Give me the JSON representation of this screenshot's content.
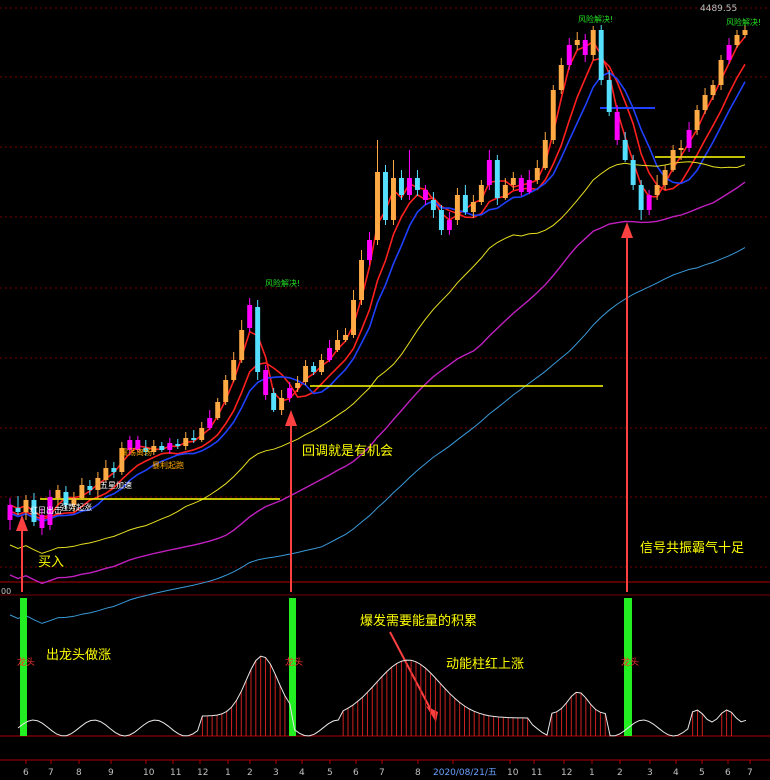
{
  "chart_data": {
    "type": "candlestick",
    "price_label": "4489.55",
    "left_marker": "00",
    "x_ticks": [
      "6",
      "7",
      "8",
      "9",
      "10",
      "11",
      "12",
      "1",
      "2",
      "3",
      "4",
      "5",
      "6",
      "7",
      "8",
      "2020/08/21/五",
      "10",
      "11",
      "12",
      "1",
      "2",
      "3",
      "4",
      "5",
      "6",
      "7"
    ],
    "bottom_date": "2020/08/21/五",
    "annotations": {
      "buy": "买入",
      "pullback": "回调就是有机会",
      "resonance": "信号共振霸气十足",
      "dragon_out": "出龙头做涨",
      "energy": "爆发需要能量的积累",
      "momentum": "动能柱红上涨",
      "dragon_tag": "龙头",
      "risk": "风险解决!",
      "small_labels": [
        "震荡离场",
        "红日出击",
        "五星加速",
        "暴利起跑",
        "强势起涨"
      ]
    },
    "candles": [
      [
        520,
        505,
        530,
        498
      ],
      [
        508,
        512,
        515,
        496
      ],
      [
        512,
        500,
        520,
        495
      ],
      [
        500,
        522,
        526,
        493
      ],
      [
        515,
        528,
        535,
        508
      ],
      [
        525,
        497,
        530,
        490
      ],
      [
        498,
        490,
        505,
        485
      ],
      [
        492,
        505,
        508,
        486
      ],
      [
        505,
        498,
        512,
        492
      ],
      [
        498,
        485,
        500,
        478
      ],
      [
        486,
        490,
        495,
        480
      ],
      [
        490,
        478,
        498,
        472
      ],
      [
        480,
        468,
        482,
        460
      ],
      [
        468,
        472,
        478,
        462
      ],
      [
        472,
        448,
        475,
        442
      ],
      [
        450,
        440,
        455,
        436
      ],
      [
        440,
        450,
        452,
        436
      ],
      [
        448,
        452,
        456,
        440
      ],
      [
        452,
        446,
        455,
        440
      ],
      [
        446,
        450,
        452,
        442
      ],
      [
        450,
        443,
        454,
        438
      ],
      [
        444,
        446,
        449,
        439
      ],
      [
        446,
        438,
        450,
        432
      ],
      [
        438,
        440,
        443,
        430
      ],
      [
        440,
        428,
        442,
        422
      ],
      [
        428,
        418,
        430,
        410
      ],
      [
        418,
        402,
        420,
        398
      ],
      [
        402,
        380,
        405,
        375
      ],
      [
        380,
        360,
        382,
        352
      ],
      [
        360,
        330,
        363,
        320
      ],
      [
        328,
        305,
        332,
        298
      ],
      [
        307,
        372,
        380,
        300
      ],
      [
        370,
        395,
        400,
        365
      ],
      [
        393,
        410,
        412,
        388
      ],
      [
        410,
        398,
        415,
        390
      ],
      [
        398,
        388,
        402,
        382
      ],
      [
        388,
        383,
        392,
        376
      ],
      [
        382,
        366,
        385,
        360
      ],
      [
        366,
        372,
        375,
        362
      ],
      [
        372,
        360,
        375,
        354
      ],
      [
        360,
        348,
        362,
        340
      ],
      [
        350,
        340,
        352,
        330
      ],
      [
        340,
        335,
        342,
        328
      ],
      [
        335,
        300,
        338,
        290
      ],
      [
        300,
        260,
        305,
        250
      ],
      [
        260,
        240,
        265,
        232
      ],
      [
        240,
        172,
        245,
        140
      ],
      [
        172,
        220,
        225,
        165
      ],
      [
        220,
        178,
        225,
        160
      ],
      [
        178,
        195,
        200,
        170
      ],
      [
        195,
        178,
        200,
        150
      ],
      [
        178,
        190,
        196,
        170
      ],
      [
        190,
        200,
        205,
        185
      ],
      [
        200,
        210,
        218,
        192
      ],
      [
        210,
        230,
        235,
        205
      ],
      [
        230,
        220,
        235,
        212
      ],
      [
        220,
        195,
        225,
        188
      ],
      [
        195,
        212,
        215,
        185
      ],
      [
        212,
        202,
        218,
        195
      ],
      [
        202,
        185,
        205,
        180
      ],
      [
        185,
        160,
        190,
        150
      ],
      [
        160,
        198,
        205,
        155
      ],
      [
        198,
        185,
        200,
        178
      ],
      [
        185,
        178,
        190,
        172
      ],
      [
        178,
        192,
        196,
        175
      ],
      [
        192,
        180,
        194,
        170
      ],
      [
        180,
        168,
        184,
        160
      ],
      [
        168,
        140,
        170,
        132
      ],
      [
        140,
        90,
        144,
        85
      ],
      [
        90,
        65,
        94,
        58
      ],
      [
        65,
        45,
        70,
        38
      ],
      [
        45,
        40,
        50,
        32
      ],
      [
        40,
        55,
        62,
        34
      ],
      [
        55,
        30,
        60,
        26
      ],
      [
        30,
        80,
        85,
        25
      ],
      [
        80,
        112,
        116,
        70
      ],
      [
        112,
        140,
        145,
        105
      ],
      [
        140,
        160,
        162,
        132
      ],
      [
        160,
        185,
        190,
        155
      ],
      [
        185,
        210,
        220,
        180
      ],
      [
        210,
        195,
        215,
        190
      ],
      [
        195,
        185,
        200,
        175
      ],
      [
        185,
        170,
        190,
        165
      ],
      [
        170,
        150,
        172,
        145
      ],
      [
        150,
        148,
        160,
        140
      ],
      [
        148,
        130,
        152,
        122
      ],
      [
        130,
        110,
        135,
        105
      ],
      [
        110,
        95,
        114,
        88
      ],
      [
        95,
        85,
        100,
        80
      ],
      [
        85,
        60,
        90,
        55
      ],
      [
        60,
        45,
        64,
        38
      ],
      [
        45,
        35,
        48,
        30
      ],
      [
        35,
        30,
        38,
        25
      ]
    ]
  }
}
